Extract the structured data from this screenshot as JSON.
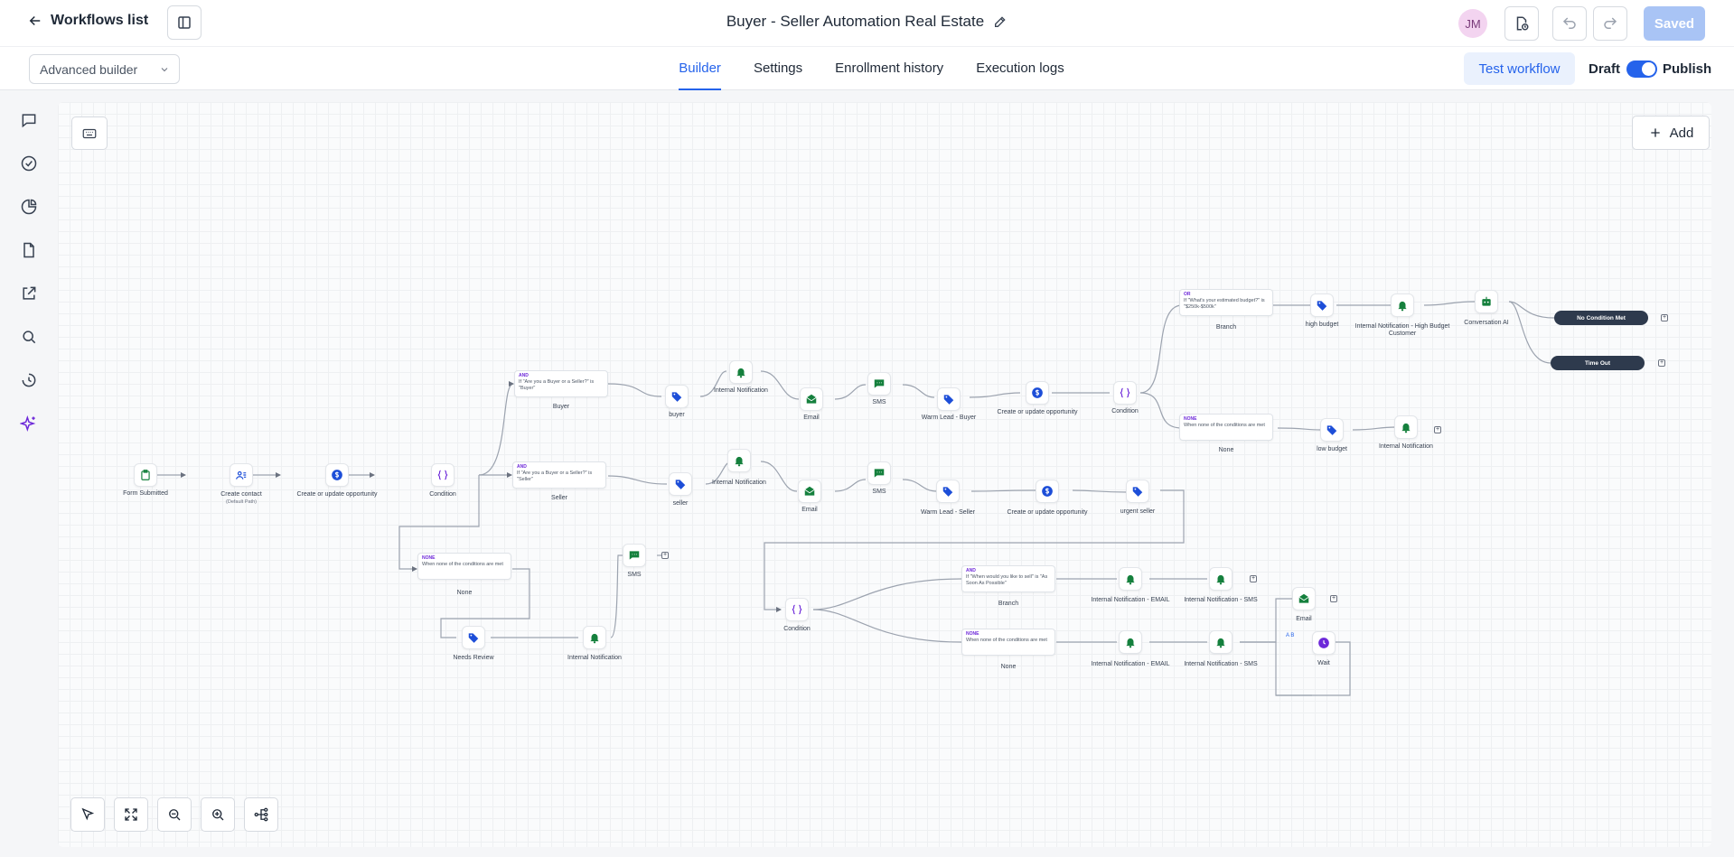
{
  "header": {
    "back_label": "Workflows list",
    "title": "Buyer - Seller Automation Real Estate",
    "avatar_initials": "JM",
    "saved_label": "Saved"
  },
  "subbar": {
    "builder_select": "Advanced builder",
    "tabs": [
      "Builder",
      "Settings",
      "Enrollment history",
      "Execution logs"
    ],
    "active_tab": "Builder",
    "test_label": "Test workflow",
    "draft_label": "Draft",
    "publish_label": "Publish",
    "publish_toggle_on": true
  },
  "canvas": {
    "add_label": "Add"
  },
  "colors": {
    "accent": "#2563eb",
    "tag_blue": "#1d4ed8",
    "action_green": "#15803d",
    "condition_purple": "#6d28d9",
    "pill_dark": "#2e3a4d"
  },
  "nodes": {
    "form_submitted": "Form Submitted",
    "create_contact": "Create contact",
    "create_contact_sub": "(Default Path)",
    "create_opp_1": "Create or update opportunity",
    "condition_1": "Condition",
    "buyer_card_tag": "AND",
    "buyer_card_text": "If \"Are you a Buyer or a Seller?\" is \"Buyer\"",
    "buyer_label": "Buyer",
    "seller_card_tag": "AND",
    "seller_card_text": "If \"Are you a Buyer or a Seller?\" is \"Seller\"",
    "seller_label": "Seller",
    "none1_card_tag": "NONE",
    "none1_card_text": "When none of the conditions are met",
    "none1_label": "None",
    "tag_buyer": "buyer",
    "notif_buyer": "Internal Notification",
    "email_buyer": "Email",
    "sms_buyer": "SMS",
    "warm_buyer": "Warm Lead - Buyer",
    "opp_buyer": "Create or update opportunity",
    "condition_buyer": "Condition",
    "budget_card_tag": "OR",
    "budget_card_text": "If \"What's your estimated budget?\" is \"$250k-$500k\"",
    "budget_branch": "Branch",
    "high_budget": "high budget",
    "notif_high": "Internal Notification - High Budget Customer",
    "conv_ai": "Conversation AI",
    "no_condition": "No Condition Met",
    "time_out": "Time Out",
    "none2_card_tag": "NONE",
    "none2_card_text": "When none of the conditions are met",
    "none2_label": "None",
    "low_budget": "low budget",
    "notif_low": "Internal Notification",
    "tag_seller": "seller",
    "notif_seller": "Internal Notification",
    "email_seller": "Email",
    "sms_seller": "SMS",
    "warm_seller": "Warm Lead - Seller",
    "opp_seller": "Create or update opportunity",
    "urgent_seller": "urgent seller",
    "condition_seller": "Condition",
    "sell_card_tag": "AND",
    "sell_card_text": "If \"When would you like to sell\" is \"As Soon As Possible\"",
    "sell_branch": "Branch",
    "notif_email_1": "Internal Notification - EMAIL",
    "notif_sms_1": "Internal Notification - SMS",
    "email_end": "Email",
    "none3_card_tag": "NONE",
    "none3_card_text": "When none of the conditions are met",
    "none3_label": "None",
    "notif_email_2": "Internal Notification - EMAIL",
    "notif_sms_2": "Internal Notification - SMS",
    "wait": "Wait",
    "ab_tag": "A B",
    "needs_review": "Needs Review",
    "notif_review": "Internal Notification",
    "sms_review": "SMS"
  }
}
